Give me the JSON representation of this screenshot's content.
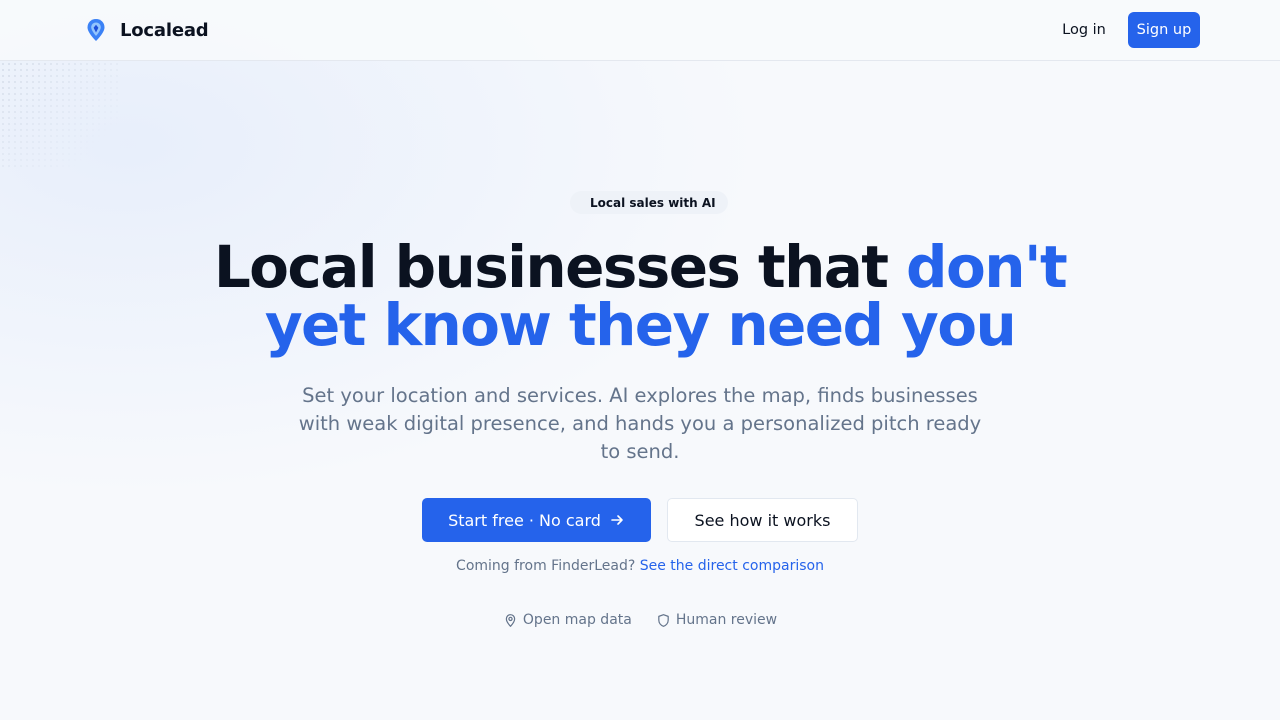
{
  "header": {
    "brand_name": "Localead",
    "login_label": "Log in",
    "signup_label": "Sign up"
  },
  "hero": {
    "badge": "Local sales with AI",
    "headline_dark": "Local businesses that ",
    "headline_blue": "don't yet know they need you",
    "subtitle": "Set your location and services. AI explores the map, finds businesses with weak digital presence, and hands you a personalized pitch ready to send.",
    "cta_primary_label": "Start free · No card",
    "cta_secondary_label": "See how it works",
    "coming_text": "Coming from FinderLead?",
    "comparison_link": "See the direct comparison",
    "features": {
      "map": "Open map data",
      "review": "Human review"
    }
  },
  "icons": {
    "brand": "map-pin-logo-icon",
    "cta": "arrow-right-icon",
    "map_feature": "map-pin-icon",
    "review_feature": "shield-icon"
  },
  "colors": {
    "accent": "#2563eb",
    "text_dark": "#0b1220",
    "text_muted": "#64748b",
    "background": "#f7f9fc"
  }
}
